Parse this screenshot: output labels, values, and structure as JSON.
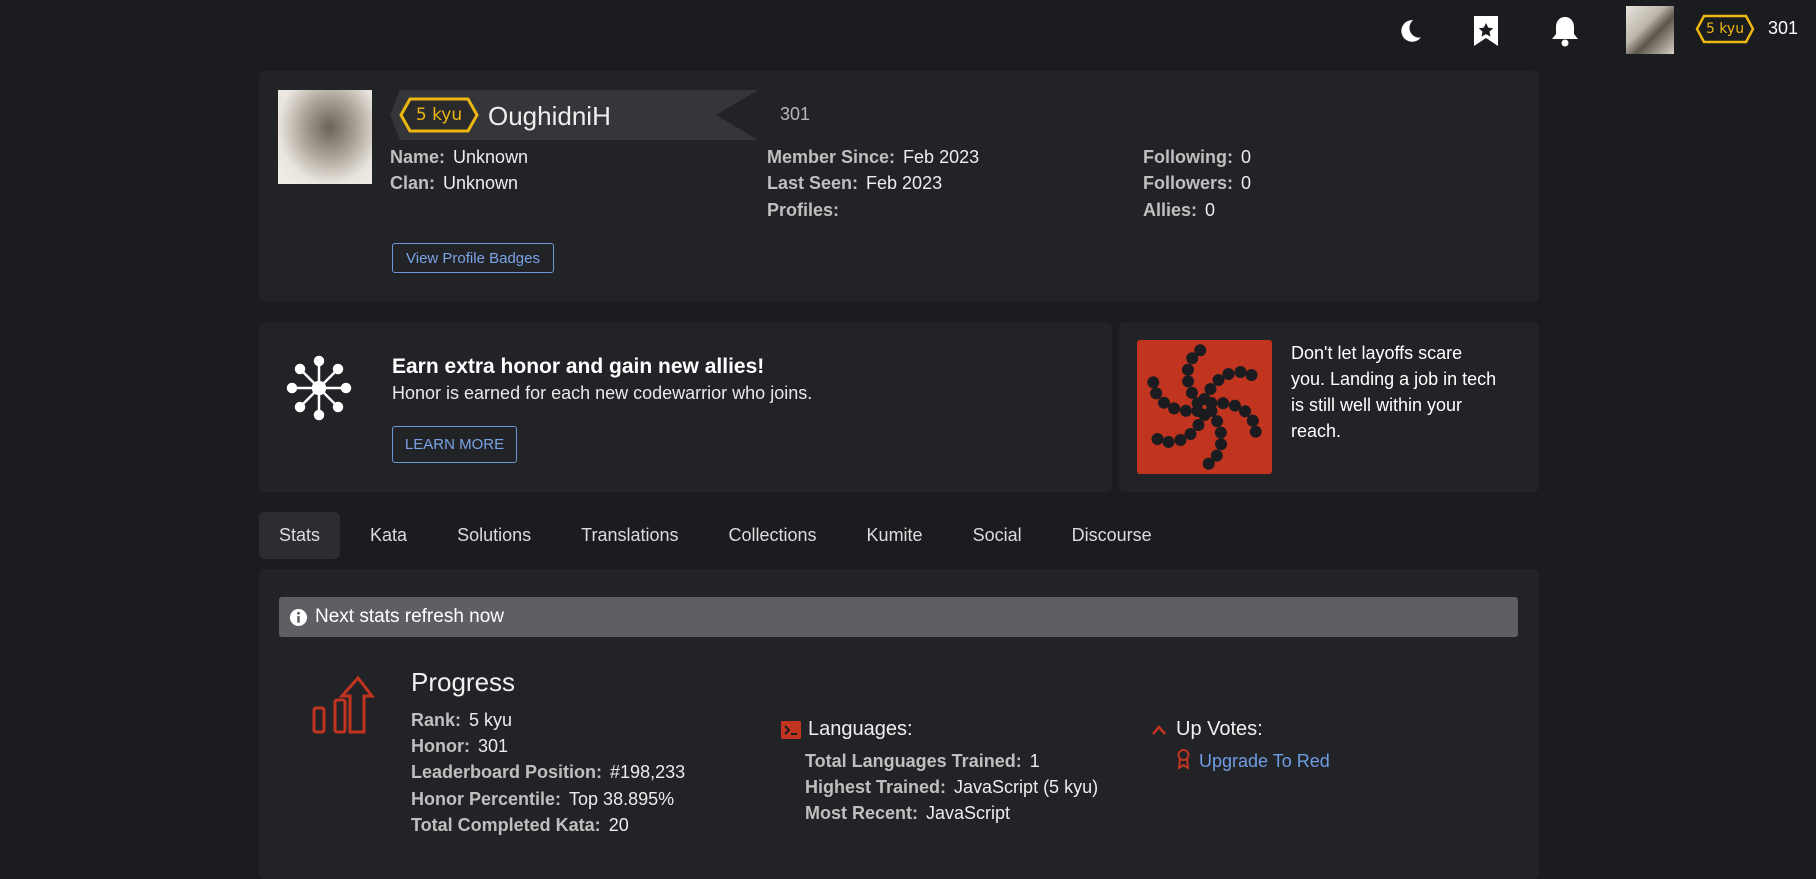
{
  "topnav": {
    "icons": [
      "moon-icon",
      "bookmark-star-icon",
      "bell-icon"
    ],
    "rank": "5 kyu",
    "honor": "301"
  },
  "profile": {
    "rank": "5 kyu",
    "username": "OughidniH",
    "honor": "301",
    "col1": [
      {
        "label": "Name:",
        "value": "Unknown"
      },
      {
        "label": "Clan:",
        "value": "Unknown"
      }
    ],
    "col2": [
      {
        "label": "Member Since:",
        "value": "Feb 2023"
      },
      {
        "label": "Last Seen:",
        "value": "Feb 2023"
      },
      {
        "label": "Profiles:",
        "value": ""
      }
    ],
    "col3": [
      {
        "label": "Following:",
        "value": "0"
      },
      {
        "label": "Followers:",
        "value": "0"
      },
      {
        "label": "Allies:",
        "value": "0"
      }
    ],
    "badges_button": "View Profile Badges"
  },
  "promo": {
    "title": "Earn extra honor and gain new allies!",
    "subtitle": "Honor is earned for each new codewarrior who joins.",
    "button": "LEARN MORE"
  },
  "ad": {
    "text": "Don't let layoffs scare you. Landing a job in tech is still well within your reach.",
    "logo_color": "#c1341f"
  },
  "tabs": [
    "Stats",
    "Kata",
    "Solutions",
    "Translations",
    "Collections",
    "Kumite",
    "Social",
    "Discourse"
  ],
  "notice": "Next stats refresh now",
  "progress": {
    "title": "Progress",
    "items": [
      {
        "label": "Rank:",
        "value": "5 kyu"
      },
      {
        "label": "Honor:",
        "value": "301"
      },
      {
        "label": "Leaderboard Position:",
        "value": "#198,233"
      },
      {
        "label": "Honor Percentile:",
        "value": "Top 38.895%"
      },
      {
        "label": "Total Completed Kata:",
        "value": "20"
      }
    ]
  },
  "languages": {
    "title": "Languages:",
    "items": [
      {
        "label": "Total Languages Trained:",
        "value": "1"
      },
      {
        "label": "Highest Trained:",
        "value": "JavaScript (5 kyu)"
      },
      {
        "label": "Most Recent:",
        "value": "JavaScript"
      }
    ]
  },
  "upvotes": {
    "title": "Up Votes:",
    "link": "Upgrade To Red"
  },
  "colors": {
    "accent_red": "#c1341f",
    "rank_yellow": "#ecb613",
    "link_blue": "#6f9de4"
  }
}
